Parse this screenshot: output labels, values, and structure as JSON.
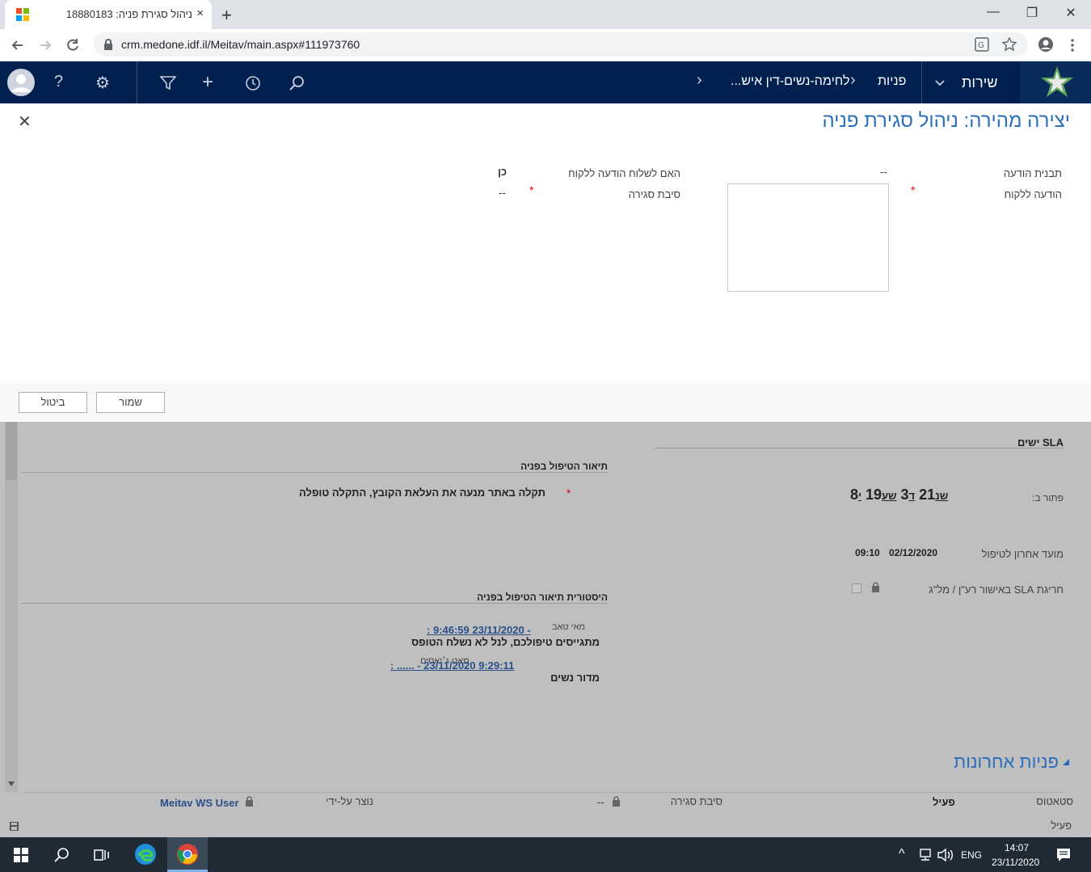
{
  "browser": {
    "tab_title": "ניהול סגירת פניה: 18880183",
    "tab_close": "×",
    "new_tab": "+",
    "url": "crm.medone.idf.il/Meitav/main.aspx#111973760",
    "window_controls": {
      "minimize": "—",
      "restore": "❐",
      "close": "✕"
    }
  },
  "crm_nav": {
    "service": "שירות",
    "requests": "פניות",
    "breadcrumb": "לחימה-נשים-דין איש...",
    "icons": [
      "avatar",
      "help-icon",
      "gear-icon",
      "filter-icon",
      "plus-icon",
      "history-icon",
      "search-icon"
    ],
    "help_glyph": "?",
    "gear_glyph": "⚙",
    "filter_glyph": "⏷",
    "plus_glyph": "+",
    "history_glyph": "↺",
    "search_glyph": "⚲",
    "chevron_right": "›",
    "chevron_left": "‹",
    "chevron_down": "⌄"
  },
  "dialog": {
    "title": "יצירה מהירה: ניהול סגירת פניה",
    "close": "✕",
    "fields": {
      "message_template_label": "תבנית הודעה",
      "message_template_value": "--",
      "send_message_label": "האם לשלוח הודעה ללקוח",
      "send_message_value": "כן",
      "customer_message_label": "הודעה ללקוח",
      "closure_reason_label": "סיבת סגירה",
      "closure_reason_value": "--",
      "required_marker": "*"
    },
    "buttons": {
      "save": "שמור",
      "cancel": "ביטול"
    }
  },
  "form": {
    "sla_header": "SLA ישים",
    "resolve_by_label": "פתור ב:",
    "timer": {
      "days": "8",
      "days_unit": "י",
      "hours": "19",
      "hours_unit": "שע",
      "minutes": "3",
      "minutes_unit": "ד",
      "seconds": "21",
      "seconds_unit": "שנ"
    },
    "last_due_label": "מועד אחרון לטיפול",
    "last_due_date": "02/12/2020",
    "last_due_time": "09:10",
    "sla_breach_label": "חריגת SLA באישור רע\"ן / מל\"ג",
    "handling_desc_header": "תיאור הטיפול בפניה",
    "handling_desc_value": "תקלה באתר מנעה את העלאת הקובץ, התקלה טופלה",
    "history_header": "היסטורית תיאור הטיפול בפניה",
    "history": [
      {
        "author": "מאי טאב",
        "link": ": 9:46:59 23/11/2020 -",
        "text": "מתגייסים טיפולכם, לנל לא נשלח הטופס"
      },
      {
        "author": "מאט ג׳יאסים",
        "link": ": ...... - 23/11/2020 9:29:11",
        "text": "מדור נשים"
      }
    ],
    "recent_requests": "פניות אחרונות",
    "footer": {
      "status_label": "סטאטוס",
      "status_value": "פעיל",
      "closure_reason_label": "סיבת סגירה",
      "closure_reason_value": "--",
      "created_by_label": "נוצר על-ידי",
      "created_by_value": "Meitav WS User",
      "bottom_status": "פעיל"
    }
  },
  "taskbar": {
    "lang": "ENG",
    "time": "14:07",
    "date": "23/11/2020"
  },
  "colors": {
    "crm_nav": "#002050",
    "title_blue": "#2a6ebb",
    "taskbar": "#1f2a35"
  }
}
